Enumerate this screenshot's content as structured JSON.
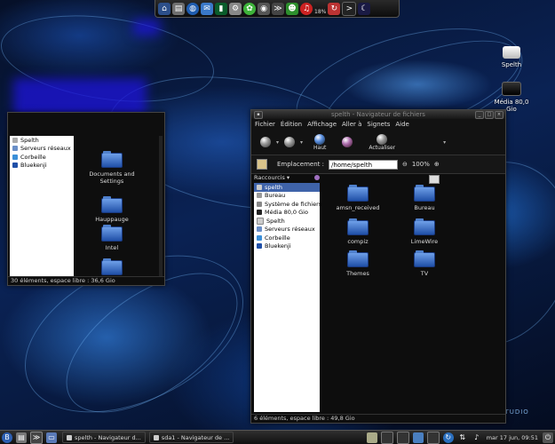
{
  "dock": {
    "items": [
      "home-icon",
      "terminal-icon",
      "globe-icon",
      "files-icon",
      "mail-icon",
      "settings-icon",
      "camera-icon",
      "chat-icon",
      "user-icon",
      "music-icon",
      "shell-icon",
      "moon-icon"
    ],
    "percent": "18%"
  },
  "desktop": {
    "drive1_label": "Spelth",
    "drive2_label": "Média 80,0 Gio",
    "studio_label": "STUDIO"
  },
  "main_window": {
    "title": "spelth - Navigateur de fichiers",
    "menu": [
      "Fichier",
      "Édition",
      "Affichage",
      "Aller à",
      "Signets",
      "Aide"
    ],
    "toolbar": {
      "up_label": "Haut",
      "refresh_label": "Actualiser"
    },
    "location_label": "Emplacement :",
    "location_value": "/home/spelth",
    "zoom": "100%",
    "sidebar_header": "Raccourcis",
    "sidebar_items": [
      "spelth",
      "Bureau",
      "Système de fichiers",
      "Média 80,0 Gio",
      "Spelth",
      "Serveurs réseaux",
      "Corbeille",
      "Bluekenji"
    ],
    "files": [
      "amsn_received",
      "Bureau",
      "compiz",
      "LimeWire",
      "Themes",
      "TV"
    ],
    "status": "6 éléments, espace libre : 49,8 Gio"
  },
  "left_window": {
    "sidebar_items": [
      "Spelth",
      "Serveurs réseaux",
      "Corbeille",
      "Bluekenji"
    ],
    "folders": [
      "Documents and Settings",
      "Hauppauge",
      "Intel",
      ""
    ],
    "status": "30 éléments, espace libre : 36,6 Gio"
  },
  "taskbar": {
    "tasks": [
      "spelth - Navigateur d...",
      "sda1 - Navigateur de ..."
    ],
    "clock": "mar 17 jun, 09:51"
  }
}
